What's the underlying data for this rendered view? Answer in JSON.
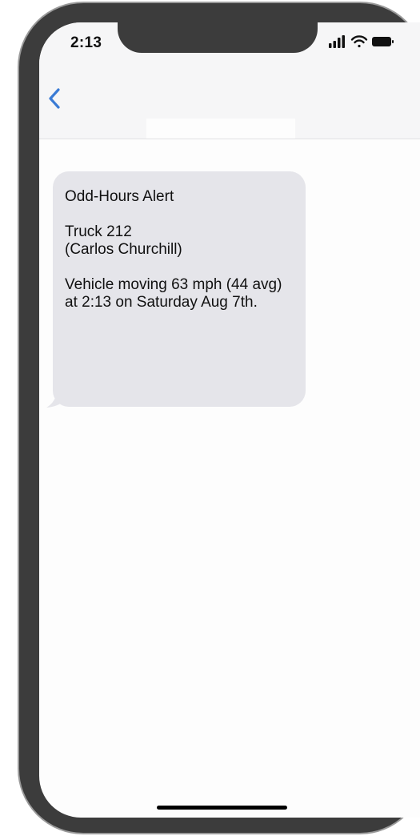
{
  "status_bar": {
    "time": "2:13",
    "icons": [
      "signal-bars-icon",
      "wifi-icon",
      "battery-icon"
    ]
  },
  "nav": {
    "back_icon": "chevron-left-icon"
  },
  "message": {
    "title": "Odd-Hours Alert",
    "vehicle": "Truck 212\n(Carlos Churchill)",
    "body": "Vehicle moving 63 mph (44 avg)\nat 2:13 on Saturday Aug 7th."
  },
  "colors": {
    "frame": "#3c3c3c",
    "bubble": "#e5e5ea",
    "accent": "#3a7bd5"
  }
}
